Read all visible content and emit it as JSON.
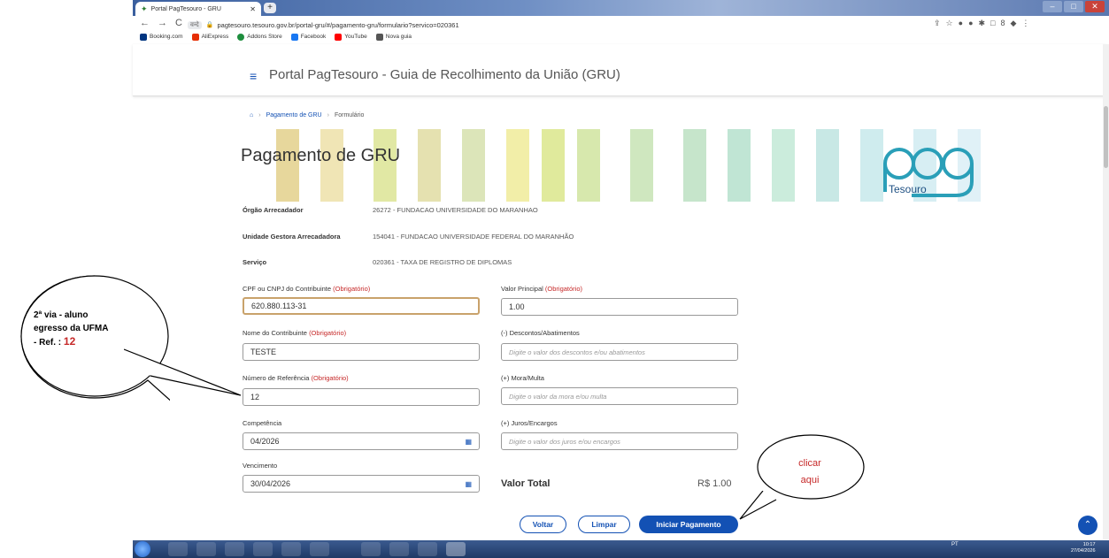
{
  "browser": {
    "tab_title": "Portal PagTesouro - GRU",
    "url_chip": "वन्दे",
    "url": "pagtesouro.tesouro.gov.br/portal-gru/#/pagamento-gru/formulario?servico=020361",
    "bookmarks": [
      "Booking.com",
      "AliExpress",
      "Addons Store",
      "Facebook",
      "YouTube",
      "Nova guia"
    ]
  },
  "header": {
    "title": "Portal PagTesouro - Guia de Recolhimento da União (GRU)"
  },
  "breadcrumb": {
    "item1": "Pagamento de GRU",
    "item2": "Formulário"
  },
  "banner": {
    "heading": "Pagamento de GRU",
    "logo_text": "pag",
    "logo_sub": "Tesouro"
  },
  "info": {
    "orgao_label": "Órgão Arrecadador",
    "orgao_value": "26272 - FUNDACAO UNIVERSIDADE DO MARANHAO",
    "ug_label": "Unidade Gestora Arrecadadora",
    "ug_value": "154041 - FUNDACAO UNIVERSIDADE FEDERAL DO MARANHÃO",
    "servico_label": "Serviço",
    "servico_value": "020361 - TAXA DE REGISTRO DE DIPLOMAS"
  },
  "form": {
    "required": "(Obrigatório)",
    "cpf_label": "CPF ou CNPJ do Contribuinte",
    "cpf_value": "620.880.113-31",
    "nome_label": "Nome do Contribuinte",
    "nome_value": "TESTE",
    "ref_label": "Número de Referência",
    "ref_value": "12",
    "comp_label": "Competência",
    "comp_value": "04/2026",
    "venc_label": "Vencimento",
    "venc_value": "30/04/2026",
    "principal_label": "Valor Principal",
    "principal_value": "1.00",
    "desc_label": "(-) Descontos/Abatimentos",
    "desc_placeholder": "Digite o valor dos descontos e/ou abatimentos",
    "mora_label": "(+) Mora/Multa",
    "mora_placeholder": "Digite o valor da mora e/ou multa",
    "juros_label": "(+) Juros/Encargos",
    "juros_placeholder": "Digite o valor dos juros e/ou encargos",
    "total_label": "Valor Total",
    "total_value": "R$ 1.00"
  },
  "buttons": {
    "voltar": "Voltar",
    "limpar": "Limpar",
    "iniciar": "Iniciar Pagamento"
  },
  "taskbar": {
    "lang": "PT",
    "time": "10:17",
    "date": "27/04/2026"
  },
  "annotations": {
    "bubble1_line1": "2ª via - aluno",
    "bubble1_line2": "egresso da UFMA",
    "bubble1_line3": "- Ref. :",
    "bubble1_ref": "12",
    "bubble2_line1": "clicar",
    "bubble2_line2": "aqui"
  }
}
